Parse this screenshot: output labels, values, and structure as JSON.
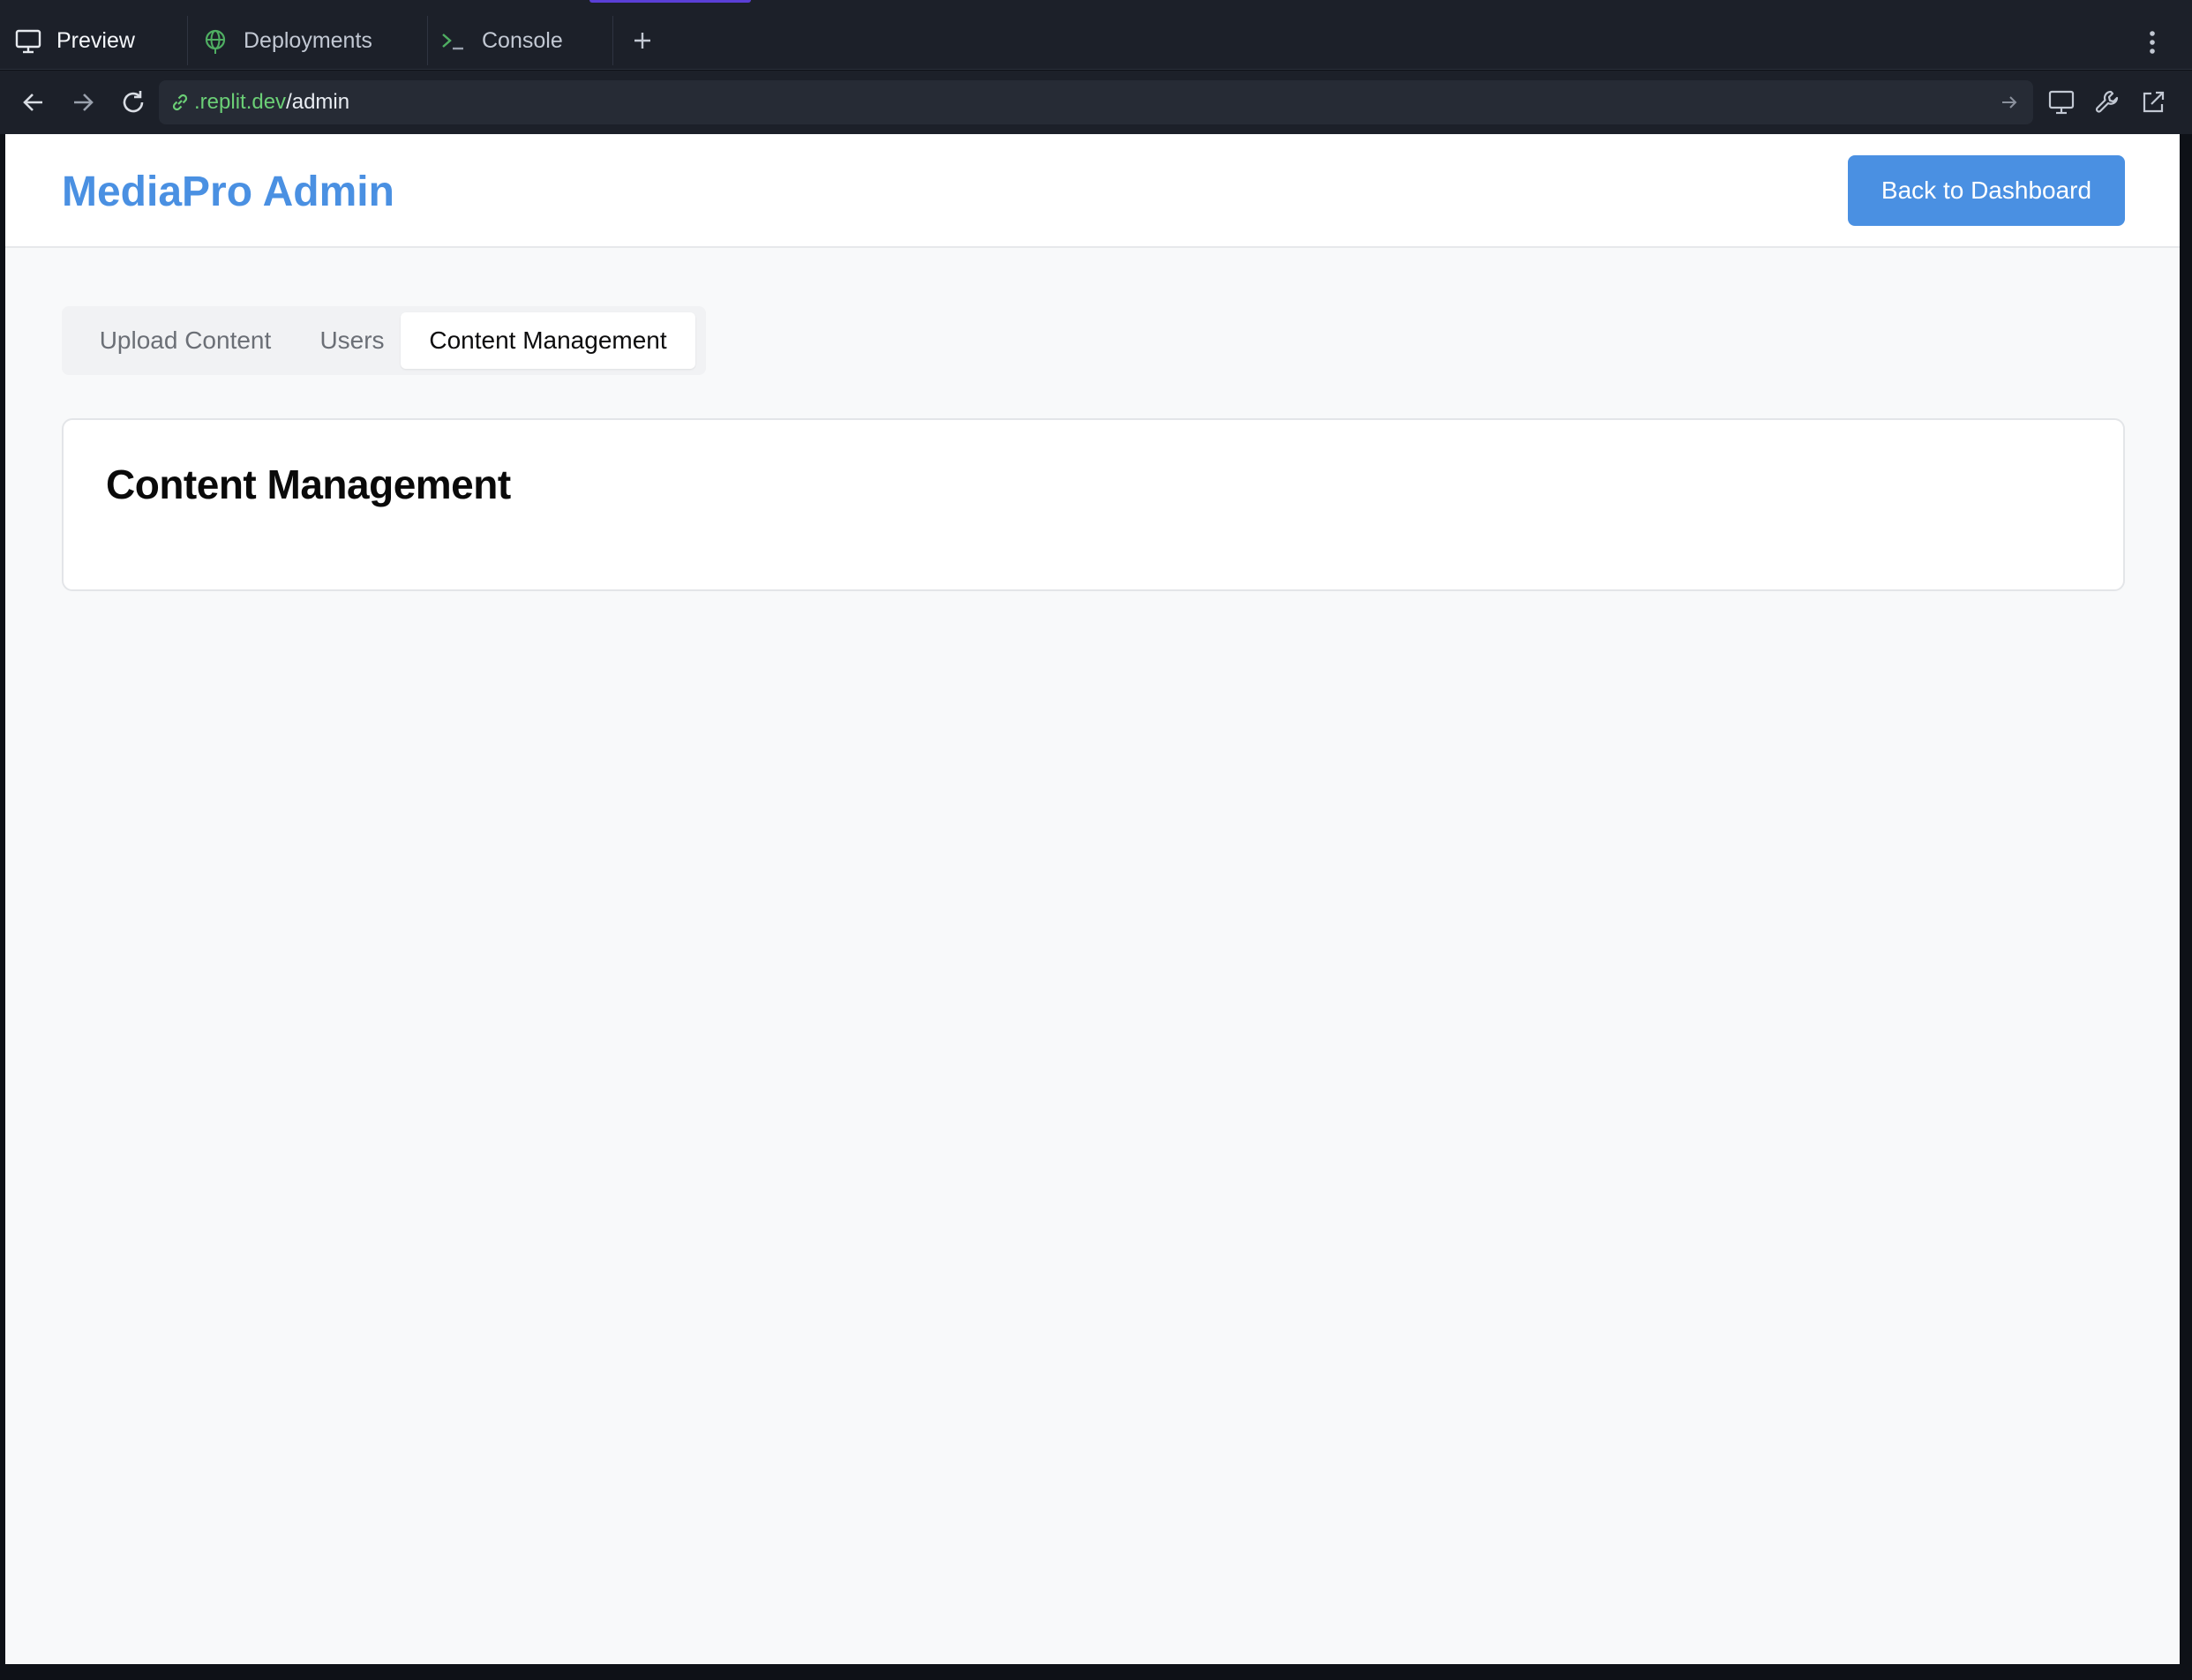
{
  "ide": {
    "tabs": [
      {
        "label": "Preview",
        "icon": "monitor-icon",
        "active": true
      },
      {
        "label": "Deployments",
        "icon": "globe-icon",
        "active": false
      },
      {
        "label": "Console",
        "icon": "terminal-icon",
        "active": false
      }
    ],
    "add_tab_icon": "plus-icon",
    "menu_icon": "kebab-menu-icon",
    "url": {
      "host": ".replit.dev",
      "path": "/admin"
    },
    "accent_color": "#5a3fd6",
    "host_color": "#6bcf76"
  },
  "app": {
    "brand": "MediaPro Admin",
    "back_button": "Back to Dashboard",
    "brand_color": "#4a90e2",
    "tabs": [
      {
        "label": "Upload Content",
        "active": false
      },
      {
        "label": "Users",
        "active": false
      },
      {
        "label": "Content Management",
        "active": true
      }
    ],
    "section_title": "Content Management"
  }
}
